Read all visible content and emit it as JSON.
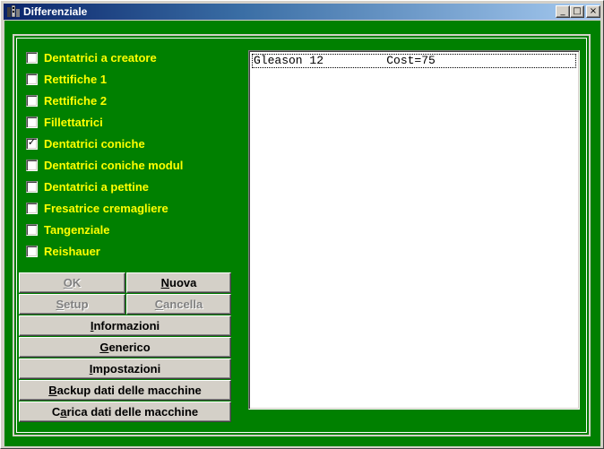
{
  "window": {
    "title": "Differenziale",
    "icon": "gear-app-icon",
    "minimize_glyph": "_",
    "maximize_glyph": "□",
    "close_glyph": "×"
  },
  "colors": {
    "client_background": "#008000",
    "label_color": "#ffff00",
    "titlebar_start": "#0a246a",
    "titlebar_end": "#a6caf0"
  },
  "checkboxes": [
    {
      "label": "Dentatrici a creatore",
      "checked": false
    },
    {
      "label": "Rettifiche 1",
      "checked": false
    },
    {
      "label": "Rettifiche 2",
      "checked": false
    },
    {
      "label": "Fillettatrici",
      "checked": false
    },
    {
      "label": "Dentatrici coniche",
      "checked": true
    },
    {
      "label": "Dentatrici coniche modul",
      "checked": false
    },
    {
      "label": "Dentatrici a pettine",
      "checked": false
    },
    {
      "label": "Fresatrice cremagliere",
      "checked": false
    },
    {
      "label": "Tangenziale",
      "checked": false
    },
    {
      "label": "Reishauer",
      "checked": false
    }
  ],
  "buttons": {
    "ok": {
      "label": "OK",
      "accel_index": 0,
      "enabled": false
    },
    "nuova": {
      "label": "Nuova",
      "accel_index": 0,
      "enabled": true
    },
    "setup": {
      "label": "Setup",
      "accel_index": 0,
      "enabled": false
    },
    "cancella": {
      "label": "Cancella",
      "accel_index": 0,
      "enabled": false
    },
    "informazioni": {
      "label": "Informazioni",
      "accel_index": 0,
      "enabled": true
    },
    "generico": {
      "label": "Generico",
      "accel_index": 0,
      "enabled": true
    },
    "impostazioni": {
      "label": "Impostazioni",
      "accel_index": 0,
      "enabled": true
    },
    "backup": {
      "label": "Backup dati delle macchine",
      "accel_index": 0,
      "enabled": true
    },
    "carica": {
      "label": "Carica dati delle macchine",
      "accel_index": 1,
      "enabled": true
    }
  },
  "machine_list": {
    "items": [
      {
        "text": "Gleason 12         Cost=75",
        "selected": true
      }
    ]
  }
}
